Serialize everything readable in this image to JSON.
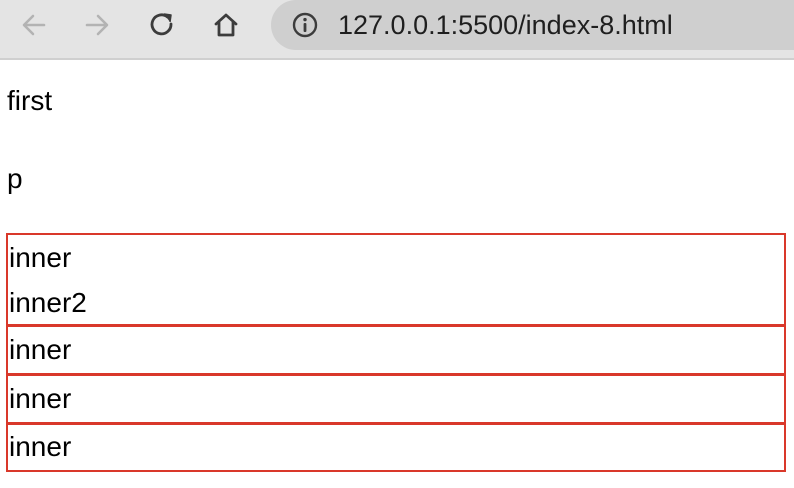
{
  "browser": {
    "url": "127.0.0.1:5500/index-8.html",
    "icons": {
      "back": "back-arrow-icon",
      "forward": "forward-arrow-icon",
      "reload": "reload-icon",
      "home": "home-icon",
      "info": "info-icon"
    }
  },
  "page": {
    "first": "first",
    "p": "p",
    "boxes": [
      {
        "lines": [
          "inner",
          "inner2"
        ]
      },
      {
        "lines": [
          "inner"
        ]
      },
      {
        "lines": [
          "inner"
        ]
      },
      {
        "lines": [
          "inner"
        ]
      }
    ]
  },
  "colors": {
    "box_border": "#d9382a",
    "toolbar_bg": "#e4e4e4",
    "address_bg": "#cfcfcf"
  }
}
